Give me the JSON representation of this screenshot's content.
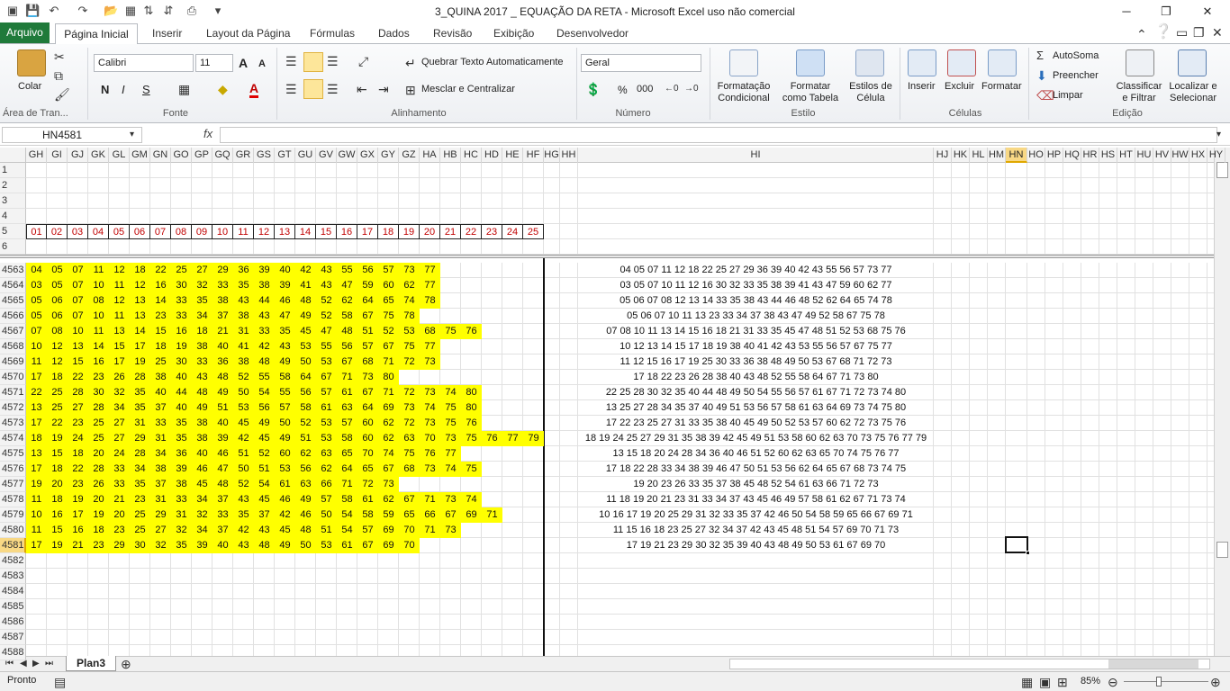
{
  "window": {
    "title": "3_QUINA 2017 _ EQUAÇÃO DA RETA  -  Microsoft Excel uso não comercial"
  },
  "tabs": [
    "Arquivo",
    "Página Inicial",
    "Inserir",
    "Layout da Página",
    "Fórmulas",
    "Dados",
    "Revisão",
    "Exibição",
    "Desenvolvedor"
  ],
  "ribbon": {
    "clipboard": {
      "paste": "Colar",
      "label": "Área de Tran..."
    },
    "font": {
      "name": "Calibri",
      "size": "11",
      "label": "Fonte",
      "bold": "N",
      "italic": "I",
      "underline": "S",
      "grow": "A",
      "shrink": "A",
      "color_a": "A"
    },
    "alignment": {
      "wrap": "Quebrar Texto Automaticamente",
      "merge": "Mesclar e Centralizar",
      "label": "Alinhamento"
    },
    "number": {
      "format": "Geral",
      "percent": "%",
      "thousands": "000",
      "label": "Número"
    },
    "styles": {
      "conditional": "Formatação Condicional",
      "as_table": "Formatar como Tabela",
      "cell_styles": "Estilos de Célula",
      "label": "Estilo"
    },
    "cells": {
      "insert": "Inserir",
      "delete": "Excluir",
      "format": "Formatar",
      "label": "Células"
    },
    "editing": {
      "autosum": "AutoSoma",
      "fill": "Preencher",
      "clear": "Limpar",
      "sort": "Classificar e Filtrar",
      "find": "Localizar e Selecionar",
      "label": "Edição"
    }
  },
  "formula_bar": {
    "name_box": "HN4581",
    "fx": "fx",
    "value": ""
  },
  "columns": [
    "GH",
    "GI",
    "GJ",
    "GK",
    "GL",
    "GM",
    "GN",
    "GO",
    "GP",
    "GQ",
    "GR",
    "GS",
    "GT",
    "GU",
    "GV",
    "GW",
    "GX",
    "GY",
    "GZ",
    "HA",
    "HB",
    "HC",
    "HD",
    "HE",
    "HF",
    "HG",
    "HH",
    "HI",
    "HJ",
    "HK",
    "HL",
    "HM",
    "HN",
    "HO",
    "HP",
    "HQ",
    "HR",
    "HS",
    "HT",
    "HU",
    "HV",
    "HW",
    "HX",
    "HY"
  ],
  "top_rows": [
    "1",
    "2",
    "3",
    "4",
    "5",
    "6"
  ],
  "header_numbers": [
    "01",
    "02",
    "03",
    "04",
    "05",
    "06",
    "07",
    "08",
    "09",
    "10",
    "11",
    "12",
    "13",
    "14",
    "15",
    "16",
    "17",
    "18",
    "19",
    "20",
    "21",
    "22",
    "23",
    "24",
    "25"
  ],
  "data_rows": [
    {
      "row": "4563",
      "values": [
        "04",
        "05",
        "07",
        "11",
        "12",
        "18",
        "22",
        "25",
        "27",
        "29",
        "36",
        "39",
        "40",
        "42",
        "43",
        "55",
        "56",
        "57",
        "73",
        "77"
      ],
      "text": "04 05 07 11 12 18 22 25 27 29 36 39 40 42 43 55 56 57 73 77"
    },
    {
      "row": "4564",
      "values": [
        "03",
        "05",
        "07",
        "10",
        "11",
        "12",
        "16",
        "30",
        "32",
        "33",
        "35",
        "38",
        "39",
        "41",
        "43",
        "47",
        "59",
        "60",
        "62",
        "77"
      ],
      "text": "03 05 07 10 11 12 16 30 32 33 35 38 39 41 43 47 59 60 62 77"
    },
    {
      "row": "4565",
      "values": [
        "05",
        "06",
        "07",
        "08",
        "12",
        "13",
        "14",
        "33",
        "35",
        "38",
        "43",
        "44",
        "46",
        "48",
        "52",
        "62",
        "64",
        "65",
        "74",
        "78"
      ],
      "text": "05 06 07 08 12 13 14 33 35 38 43 44 46 48 52 62 64 65 74 78"
    },
    {
      "row": "4566",
      "values": [
        "05",
        "06",
        "07",
        "10",
        "11",
        "13",
        "23",
        "33",
        "34",
        "37",
        "38",
        "43",
        "47",
        "49",
        "52",
        "58",
        "67",
        "75",
        "78"
      ],
      "text": "05 06 07 10 11 13 23 33 34 37 38 43 47 49 52 58 67 75 78"
    },
    {
      "row": "4567",
      "values": [
        "07",
        "08",
        "10",
        "11",
        "13",
        "14",
        "15",
        "16",
        "18",
        "21",
        "31",
        "33",
        "35",
        "45",
        "47",
        "48",
        "51",
        "52",
        "53",
        "68",
        "75",
        "76"
      ],
      "text": "07 08 10 11 13 14 15 16 18 21 31 33 35 45 47 48 51 52 53 68 75 76"
    },
    {
      "row": "4568",
      "values": [
        "10",
        "12",
        "13",
        "14",
        "15",
        "17",
        "18",
        "19",
        "38",
        "40",
        "41",
        "42",
        "43",
        "53",
        "55",
        "56",
        "57",
        "67",
        "75",
        "77"
      ],
      "text": "10 12 13 14 15 17 18 19 38 40 41 42 43 53 55 56 57 67 75 77"
    },
    {
      "row": "4569",
      "values": [
        "11",
        "12",
        "15",
        "16",
        "17",
        "19",
        "25",
        "30",
        "33",
        "36",
        "38",
        "48",
        "49",
        "50",
        "53",
        "67",
        "68",
        "71",
        "72",
        "73"
      ],
      "text": "11 12 15 16 17 19 25 30 33 36 38 48 49 50 53 67 68 71 72 73"
    },
    {
      "row": "4570",
      "values": [
        "17",
        "18",
        "22",
        "23",
        "26",
        "28",
        "38",
        "40",
        "43",
        "48",
        "52",
        "55",
        "58",
        "64",
        "67",
        "71",
        "73",
        "80"
      ],
      "text": "17 18 22 23 26 28 38 40 43 48 52 55 58 64 67 71 73 80"
    },
    {
      "row": "4571",
      "values": [
        "22",
        "25",
        "28",
        "30",
        "32",
        "35",
        "40",
        "44",
        "48",
        "49",
        "50",
        "54",
        "55",
        "56",
        "57",
        "61",
        "67",
        "71",
        "72",
        "73",
        "74",
        "80"
      ],
      "text": "22 25 28 30 32 35 40 44 48 49 50 54 55 56 57 61 67 71 72 73 74 80"
    },
    {
      "row": "4572",
      "values": [
        "13",
        "25",
        "27",
        "28",
        "34",
        "35",
        "37",
        "40",
        "49",
        "51",
        "53",
        "56",
        "57",
        "58",
        "61",
        "63",
        "64",
        "69",
        "73",
        "74",
        "75",
        "80"
      ],
      "text": "13 25 27 28 34 35 37 40 49 51 53 56 57 58 61 63 64 69 73 74 75 80"
    },
    {
      "row": "4573",
      "values": [
        "17",
        "22",
        "23",
        "25",
        "27",
        "31",
        "33",
        "35",
        "38",
        "40",
        "45",
        "49",
        "50",
        "52",
        "53",
        "57",
        "60",
        "62",
        "72",
        "73",
        "75",
        "76"
      ],
      "text": "17 22 23 25 27 31 33 35 38 40 45 49 50 52 53 57 60 62 72 73 75 76"
    },
    {
      "row": "4574",
      "values": [
        "18",
        "19",
        "24",
        "25",
        "27",
        "29",
        "31",
        "35",
        "38",
        "39",
        "42",
        "45",
        "49",
        "51",
        "53",
        "58",
        "60",
        "62",
        "63",
        "70",
        "73",
        "75",
        "76",
        "77",
        "79"
      ],
      "text": "18 19 24 25 27 29 31 35 38 39 42 45 49 51 53 58 60 62 63 70 73 75 76 77 79"
    },
    {
      "row": "4575",
      "values": [
        "13",
        "15",
        "18",
        "20",
        "24",
        "28",
        "34",
        "36",
        "40",
        "46",
        "51",
        "52",
        "60",
        "62",
        "63",
        "65",
        "70",
        "74",
        "75",
        "76",
        "77"
      ],
      "text": "13 15 18 20 24 28 34 36 40 46 51 52 60 62 63 65 70 74 75 76 77"
    },
    {
      "row": "4576",
      "values": [
        "17",
        "18",
        "22",
        "28",
        "33",
        "34",
        "38",
        "39",
        "46",
        "47",
        "50",
        "51",
        "53",
        "56",
        "62",
        "64",
        "65",
        "67",
        "68",
        "73",
        "74",
        "75"
      ],
      "text": "17 18 22 28 33 34 38 39 46 47 50 51 53 56 62 64 65 67 68 73 74 75"
    },
    {
      "row": "4577",
      "values": [
        "19",
        "20",
        "23",
        "26",
        "33",
        "35",
        "37",
        "38",
        "45",
        "48",
        "52",
        "54",
        "61",
        "63",
        "66",
        "71",
        "72",
        "73"
      ],
      "text": "19 20 23 26 33 35 37 38 45 48 52 54 61 63 66 71 72 73"
    },
    {
      "row": "4578",
      "values": [
        "11",
        "18",
        "19",
        "20",
        "21",
        "23",
        "31",
        "33",
        "34",
        "37",
        "43",
        "45",
        "46",
        "49",
        "57",
        "58",
        "61",
        "62",
        "67",
        "71",
        "73",
        "74"
      ],
      "text": "11 18 19 20 21 23 31 33 34 37 43 45 46 49 57 58 61 62 67 71 73 74"
    },
    {
      "row": "4579",
      "values": [
        "10",
        "16",
        "17",
        "19",
        "20",
        "25",
        "29",
        "31",
        "32",
        "33",
        "35",
        "37",
        "42",
        "46",
        "50",
        "54",
        "58",
        "59",
        "65",
        "66",
        "67",
        "69",
        "71"
      ],
      "text": "10 16 17 19 20 25 29 31 32 33 35 37 42 46 50 54 58 59 65 66 67 69 71"
    },
    {
      "row": "4580",
      "values": [
        "11",
        "15",
        "16",
        "18",
        "23",
        "25",
        "27",
        "32",
        "34",
        "37",
        "42",
        "43",
        "45",
        "48",
        "51",
        "54",
        "57",
        "69",
        "70",
        "71",
        "73"
      ],
      "text": "11 15 16 18 23 25 27 32 34 37 42 43 45 48 51 54 57 69 70 71 73"
    },
    {
      "row": "4581",
      "values": [
        "17",
        "19",
        "21",
        "23",
        "29",
        "30",
        "32",
        "35",
        "39",
        "40",
        "43",
        "48",
        "49",
        "50",
        "53",
        "61",
        "67",
        "69",
        "70"
      ],
      "text": "17 19 21 23 29 30 32 35 39 40 43 48 49 50 53 61 67 69 70"
    }
  ],
  "empty_rows": [
    "4582",
    "4583",
    "4584",
    "4585",
    "4586",
    "4587",
    "4588"
  ],
  "sheets": {
    "active": "Plan3"
  },
  "status": {
    "ready": "Pronto",
    "zoom": "85%"
  },
  "colors": {
    "highlight": "#ffff00",
    "header_number": "#c00000",
    "file_tab": "#1f7a3a"
  }
}
